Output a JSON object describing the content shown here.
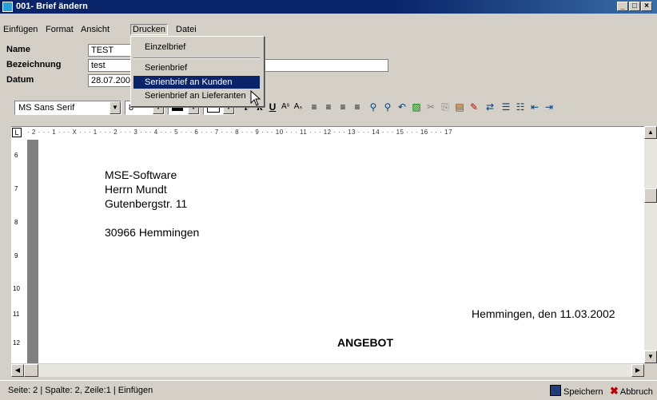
{
  "window": {
    "title": "001- Brief ändern"
  },
  "menubar": {
    "items": [
      "Einfügen",
      "Format",
      "Ansicht",
      "Drucken",
      "Datei"
    ]
  },
  "form": {
    "name_label": "Name",
    "name_value": "TEST",
    "bezeichnung_label": "Bezeichnung",
    "bezeichnung_value": "test",
    "datum_label": "Datum",
    "datum_value": "28.07.200"
  },
  "drucken_menu": {
    "items": [
      "Einzelbrief",
      "Serienbrief",
      "Serienbrief an Kunden",
      "Serienbrief an Lieferanten"
    ],
    "selected": "Serienbrief an Kunden"
  },
  "toolbar": {
    "font": "MS Sans Serif",
    "size": "8"
  },
  "ruler": {
    "text": "· 2 · · · 1 · · · X · · · 1 · · · 2 · · · 3 · · · 4 · · · 5 · · · 6 · · · 7 · · · 8 · · · 9 · · · 10 · · · 11 · · · 12 · · · 13 · · · 14 · · · 15 · · · 16 · · · 17"
  },
  "vruler": {
    "marks": [
      "6",
      "7",
      "8",
      "9",
      "10",
      "11",
      "12"
    ]
  },
  "document": {
    "address": [
      "MSE-Software",
      "Herrn Mundt",
      "Gutenbergstr. 11"
    ],
    "city": "30966 Hemmingen",
    "date_line": "Hemmingen, den 11.03.2002",
    "heading": "ANGEBOT"
  },
  "statusbar": {
    "text": "Seite: 2 | Spalte: 2, Zeile:1 | Einfügen",
    "save_label": "Speichern",
    "cancel_label": "Abbruch"
  }
}
